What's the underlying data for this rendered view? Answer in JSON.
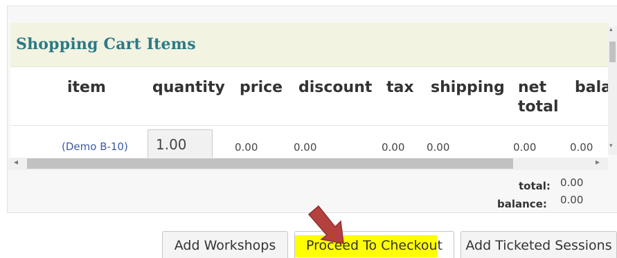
{
  "cart": {
    "title": "Shopping Cart Items",
    "columns": {
      "item": "item",
      "quantity": "quantity",
      "price": "price",
      "discount": "discount",
      "tax": "tax",
      "shipping": "shipping",
      "net_total": "net total",
      "balance": "bala"
    },
    "rows": [
      {
        "item": "(Demo B-10)",
        "quantity": "1.00",
        "price": "0.00",
        "discount": "0.00",
        "tax": "0.00",
        "shipping": "0.00",
        "net_total": "0.00",
        "balance": "0.00"
      }
    ],
    "totals": {
      "total_label": "total:",
      "total_value": "0.00",
      "balance_label": "balance:",
      "balance_value": "0.00"
    }
  },
  "scroll": {
    "left_arrow": "◂",
    "right_arrow": "▸",
    "up_arrow": "▴",
    "down_arrow": "▾"
  },
  "buttons": {
    "add_workshops": "Add Workshops",
    "proceed_to_checkout": "Proceed To Checkout",
    "add_ticketed_sessions": "Add Ticketed Sessions"
  },
  "annotation": {
    "arrow_color": "#b5413f",
    "highlight_color": "#ffff00"
  }
}
